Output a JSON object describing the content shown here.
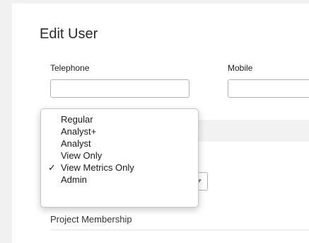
{
  "form": {
    "title": "Edit User",
    "telephone_label": "Telephone",
    "telephone_value": "",
    "mobile_label": "Mobile",
    "mobile_value": "",
    "project_membership_label": "Project Membership"
  },
  "role_dropdown": {
    "options": [
      {
        "label": "Regular",
        "selected": false
      },
      {
        "label": "Analyst+",
        "selected": false
      },
      {
        "label": "Analyst",
        "selected": false
      },
      {
        "label": "View Only",
        "selected": false
      },
      {
        "label": "View Metrics Only",
        "selected": true
      },
      {
        "label": "Admin",
        "selected": false
      }
    ],
    "check_glyph": "✓"
  }
}
